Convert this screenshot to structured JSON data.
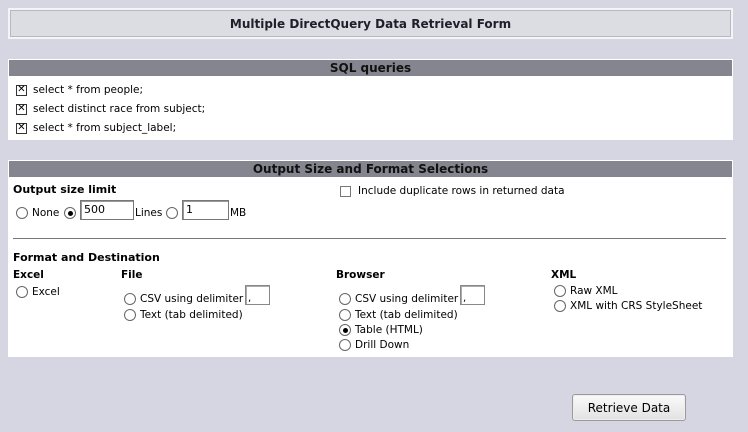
{
  "title": "Multiple DirectQuery Data Retrieval Form",
  "sql": {
    "header": "SQL queries",
    "queries": [
      {
        "text": "select * from people;",
        "checked": true
      },
      {
        "text": "select distinct race from subject;",
        "checked": true
      },
      {
        "text": "select * from subject_label;",
        "checked": true
      }
    ]
  },
  "output": {
    "header": "Output Size and Format Selections",
    "size_limit_label": "Output size limit",
    "none_label": "None",
    "lines_value": "500",
    "lines_label": "Lines",
    "mb_value": "1",
    "mb_label": "MB",
    "include_duplicates_label": "Include duplicate rows in returned data",
    "format_label": "Format and Destination",
    "excel": {
      "heading": "Excel",
      "option": "Excel"
    },
    "file": {
      "heading": "File",
      "csv": "CSV using delimiter",
      "csv_delim": ",",
      "text": "Text (tab delimited)"
    },
    "browser": {
      "heading": "Browser",
      "csv": "CSV using delimiter",
      "csv_delim": ",",
      "text": "Text (tab delimited)",
      "table": "Table (HTML)",
      "drill": "Drill Down"
    },
    "xml": {
      "heading": "XML",
      "raw": "Raw XML",
      "crs": "XML with CRS StyleSheet"
    }
  },
  "retrieve_button": "Retrieve Data"
}
